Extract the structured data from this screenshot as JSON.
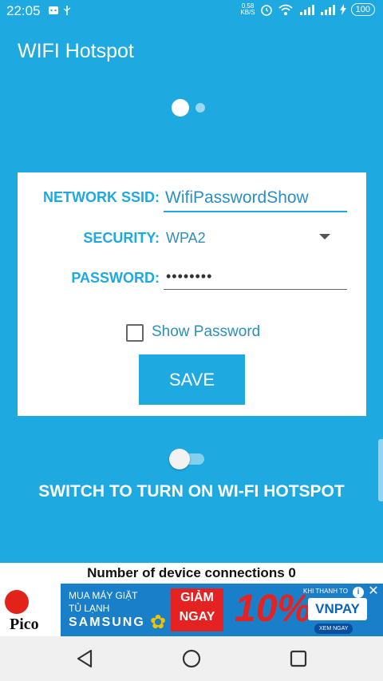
{
  "status_bar": {
    "time": "22:05",
    "speed_value": "0.58",
    "speed_unit": "KB/S",
    "battery": "100"
  },
  "app": {
    "title": "WIFI Hotspot",
    "accent_color": "#1ea9e1"
  },
  "form": {
    "ssid_label": "NETWORK SSID:",
    "ssid_value": "WifiPasswordShow",
    "security_label": "SECURITY:",
    "security_value": "WPA2",
    "password_label": "PASSWORD:",
    "password_value": "••••••••",
    "show_password_label": "Show Password",
    "show_password_checked": false,
    "save_label": "SAVE"
  },
  "hotspot": {
    "switch_label": "SWITCH TO TURN ON WI-FI HOTSPOT",
    "enabled": false,
    "connections_text": "Number of device connections 0"
  },
  "ad": {
    "line1": "MUA MÁY GIẶT",
    "line2": "TỦ LẠNH",
    "brand": "SAMSUNG",
    "discount_line1": "GIẢM",
    "discount_line2": "NGAY",
    "percent": "10%",
    "payment_note": "KHI THANH TO",
    "payment_brand": "VNPAY",
    "cta": "XEM NGAY",
    "advertiser": "Pico"
  }
}
